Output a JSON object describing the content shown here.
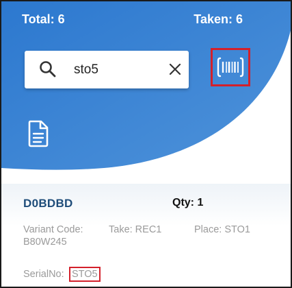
{
  "header": {
    "total_label": "Total: 6",
    "taken_label": "Taken: 6",
    "colors": {
      "header_top": "#2f7dd1",
      "header_bottom": "#4a8fd8",
      "highlight": "#d3202b"
    }
  },
  "search": {
    "value": "sto5",
    "search_icon": "search-icon",
    "clear_icon": "close-icon"
  },
  "scan": {
    "icon": "barcode-scan-icon"
  },
  "document": {
    "icon": "document-icon"
  },
  "item": {
    "title": "D0BDBD",
    "qty_label": "Qty: 1",
    "variant_label": "Variant Code:",
    "variant_value": "B80W245",
    "take_label": "Take: REC1",
    "place_label": "Place: STO1",
    "serial_label": "SerialNo:",
    "serial_value": "STO5"
  }
}
